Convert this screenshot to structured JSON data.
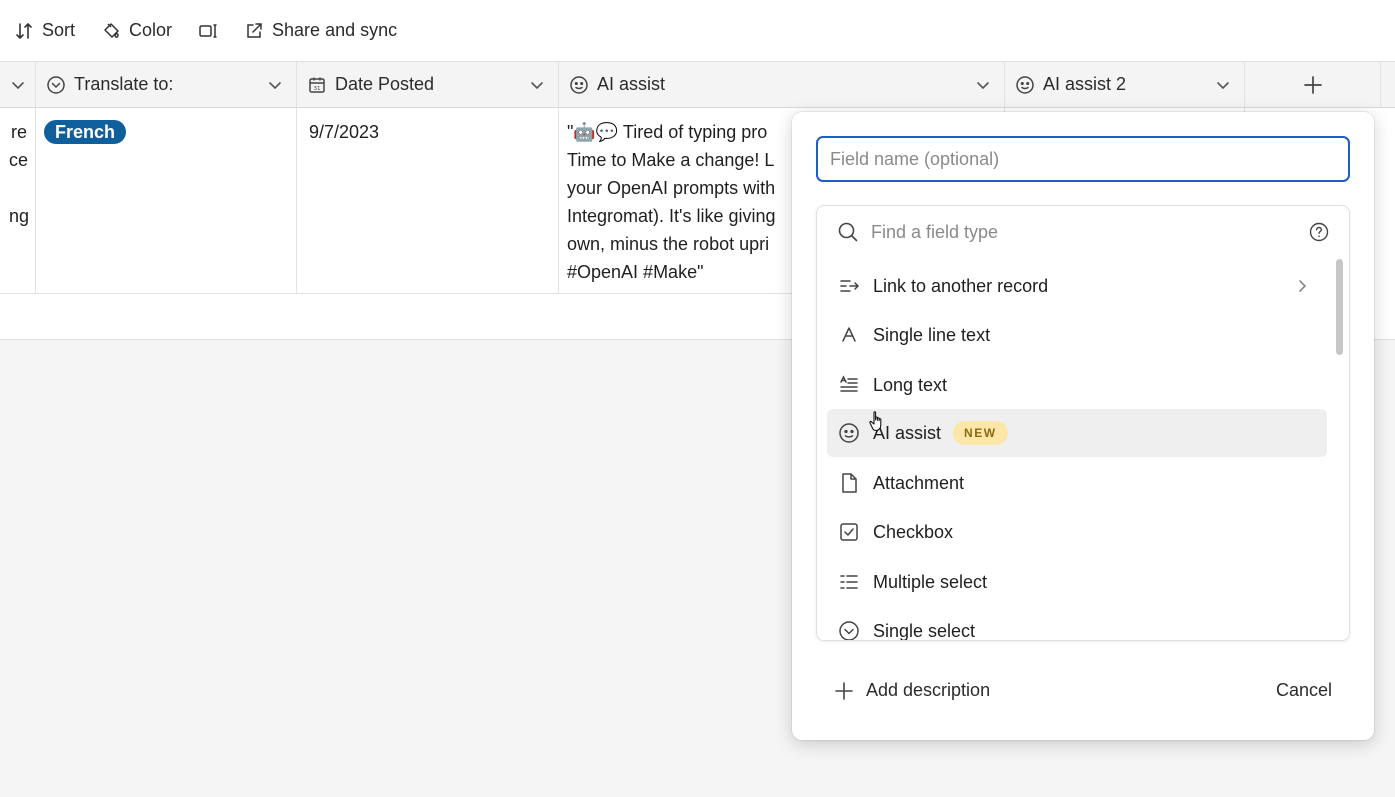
{
  "toolbar": {
    "sort": "Sort",
    "color": "Color",
    "share": "Share and sync"
  },
  "headers": {
    "translate": "Translate to:",
    "date": "Date Posted",
    "ai_assist": "AI assist",
    "ai_assist_2": "AI assist 2"
  },
  "row": {
    "partial_lines": [
      "re",
      "ce",
      "",
      "ng"
    ],
    "translate_value": "French",
    "date_value": "9/7/2023",
    "ai_lines": [
      "\"🤖💬 Tired of typing pro",
      "Time to Make a change! L",
      "your OpenAI prompts with",
      "Integromat). It's like giving",
      "own, minus the robot upri",
      "#OpenAI #Make\""
    ]
  },
  "popup": {
    "name_placeholder": "Field name (optional)",
    "search_placeholder": "Find a field type",
    "field_types": [
      {
        "label": "Link to another record",
        "icon": "link-record-icon"
      },
      {
        "label": "Single line text",
        "icon": "single-line-text-icon"
      },
      {
        "label": "Long text",
        "icon": "long-text-icon"
      },
      {
        "label": "AI assist",
        "icon": "ai-assist-icon",
        "badge": "NEW"
      },
      {
        "label": "Attachment",
        "icon": "attachment-icon"
      },
      {
        "label": "Checkbox",
        "icon": "checkbox-icon"
      },
      {
        "label": "Multiple select",
        "icon": "multiple-select-icon"
      },
      {
        "label": "Single select",
        "icon": "single-select-icon"
      }
    ],
    "add_description": "Add description",
    "cancel": "Cancel"
  },
  "colors": {
    "accent": "#1e5ec8",
    "pill": "#0f5f9c",
    "badge_bg": "#fde7a8",
    "badge_text": "#8a6a12"
  }
}
